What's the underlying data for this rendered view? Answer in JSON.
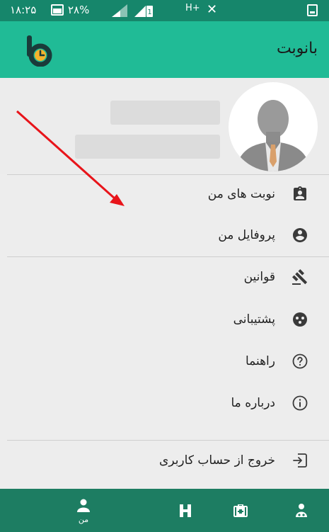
{
  "status_bar": {
    "time": "۱۸:۲۵",
    "battery": "۲۸%",
    "network": "H+"
  },
  "app_bar": {
    "title": "بانوبت",
    "logo_icon": "banobat-logo-icon"
  },
  "menu": {
    "group1": [
      {
        "label": "نوبت های من",
        "icon": "assignment-ind-icon"
      },
      {
        "label": "پروفایل من",
        "icon": "account-circle-icon"
      }
    ],
    "group2": [
      {
        "label": "قوانین",
        "icon": "gavel-icon"
      },
      {
        "label": "پشتیبانی",
        "icon": "support-icon"
      },
      {
        "label": "راهنما",
        "icon": "help-circle-icon"
      },
      {
        "label": "درباره ما",
        "icon": "info-icon"
      }
    ],
    "logout": {
      "label": "خروج از حساب کاربری",
      "icon": "logout-icon"
    }
  },
  "bottom_nav": {
    "items": [
      {
        "label": "من",
        "icon": "person-icon",
        "active": true
      },
      {
        "label": "",
        "icon": "hospital-h-icon"
      },
      {
        "label": "",
        "icon": "medical-kit-icon"
      },
      {
        "label": "",
        "icon": "doctors-icon"
      }
    ]
  },
  "colors": {
    "status_bar": "#16866b",
    "app_bar": "#20bb96",
    "bottom_nav": "#1d7d62",
    "background": "#ededed",
    "annotation_arrow": "#e8141a"
  }
}
